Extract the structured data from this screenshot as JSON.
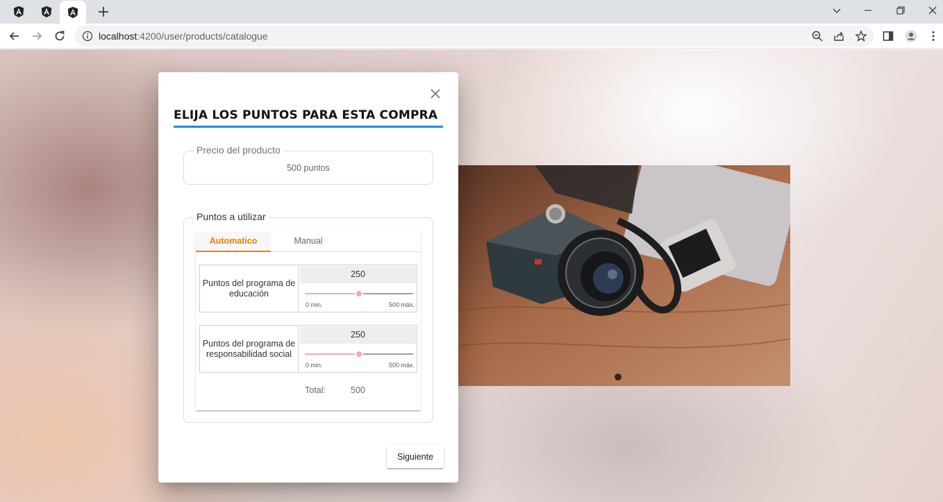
{
  "browser": {
    "tabs": [
      {
        "icon": "angular-icon"
      },
      {
        "icon": "angular-icon"
      },
      {
        "icon": "angular-icon",
        "active": true
      }
    ],
    "new_tab_label": "+",
    "url_host": "localhost",
    "url_path": ":4200/user/products/catalogue"
  },
  "dialog": {
    "title": "ELIJA LOS PUNTOS PARA ESTA COMPRA",
    "price_section": {
      "legend": "Precio del producto",
      "value": "500 puntos"
    },
    "points_section": {
      "legend": "Puntos a utilizar",
      "tabs": [
        {
          "label": "Automatico",
          "active": true
        },
        {
          "label": "Manual",
          "active": false
        }
      ],
      "rows": [
        {
          "label": "Puntos del programa de educación",
          "value": "250",
          "slider_value": 250,
          "min_label": "0 min.",
          "max_label": "500 máx.",
          "min": 0,
          "max": 500
        },
        {
          "label": "Puntos del programa de responsabilidad social",
          "value": "250",
          "slider_value": 250,
          "min_label": "0 min.",
          "max_label": "500 máx.",
          "min": 0,
          "max": 500
        }
      ],
      "total_label": "Total:",
      "total_value": "500"
    },
    "next_button": "Siguiente"
  },
  "colors": {
    "accent_blue": "#1e88e5",
    "tab_active": "#f57c00",
    "slider": "#f4a7b9"
  }
}
